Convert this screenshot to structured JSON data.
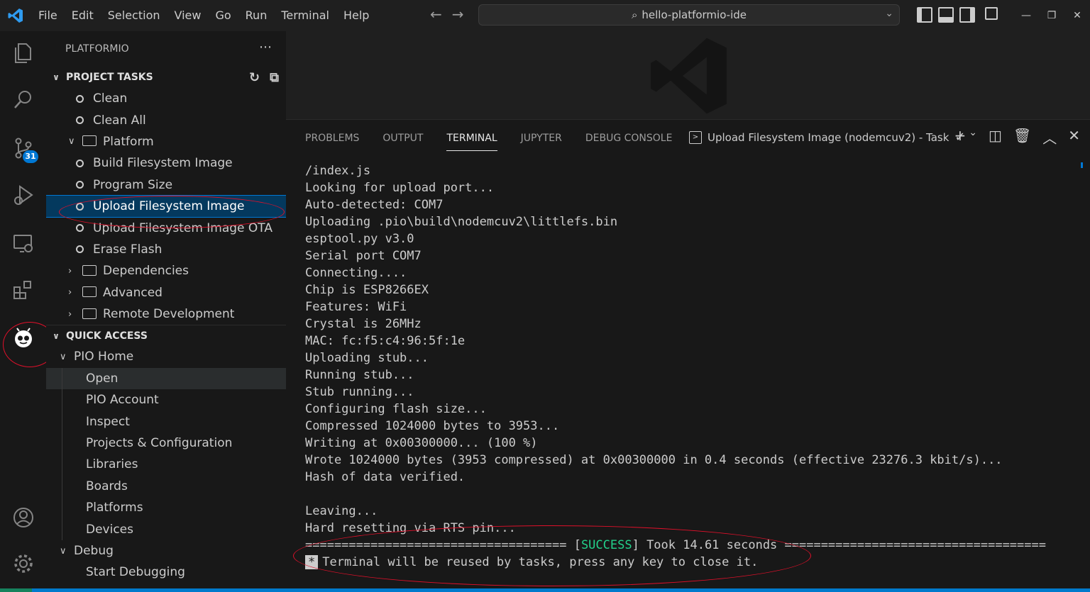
{
  "titlebar": {
    "menu": [
      "File",
      "Edit",
      "Selection",
      "View",
      "Go",
      "Run",
      "Terminal",
      "Help"
    ],
    "search_text": "hello-platformio-ide"
  },
  "activitybar": {
    "scm_badge": "31"
  },
  "sidebar": {
    "title": "PLATFORMIO",
    "project_tasks": {
      "header": "PROJECT TASKS",
      "items": {
        "clean": "Clean",
        "clean_all": "Clean All",
        "platform": "Platform",
        "build_fs": "Build Filesystem Image",
        "program_size": "Program Size",
        "upload_fs": "Upload Filesystem Image",
        "upload_fs_ota": "Upload Filesystem Image OTA",
        "erase_flash": "Erase Flash",
        "dependencies": "Dependencies",
        "advanced": "Advanced",
        "remote_dev": "Remote Development"
      }
    },
    "quick_access": {
      "header": "QUICK ACCESS",
      "pio_home": "PIO Home",
      "open": "Open",
      "pio_account": "PIO Account",
      "inspect": "Inspect",
      "projects": "Projects & Configuration",
      "libraries": "Libraries",
      "boards": "Boards",
      "platforms": "Platforms",
      "devices": "Devices",
      "debug": "Debug",
      "start_debugging": "Start Debugging"
    }
  },
  "panel": {
    "tabs": {
      "problems": "PROBLEMS",
      "output": "OUTPUT",
      "terminal": "TERMINAL",
      "jupyter": "JUPYTER",
      "debug_console": "DEBUG CONSOLE"
    },
    "task_name": "Upload Filesystem Image (nodemcuv2) - Task",
    "terminal_lines": {
      "l1": "/index.js",
      "l2": "Looking for upload port...",
      "l3": "Auto-detected: COM7",
      "l4": "Uploading .pio\\build\\nodemcuv2\\littlefs.bin",
      "l5": "esptool.py v3.0",
      "l6": "Serial port COM7",
      "l7": "Connecting....",
      "l8": "Chip is ESP8266EX",
      "l9": "Features: WiFi",
      "l10": "Crystal is 26MHz",
      "l11": "MAC: fc:f5:c4:96:5f:1e",
      "l12": "Uploading stub...",
      "l13": "Running stub...",
      "l14": "Stub running...",
      "l15": "Configuring flash size...",
      "l16": "Compressed 1024000 bytes to 3953...",
      "l17": "Writing at 0x00300000... (100 %)",
      "l18": "Wrote 1024000 bytes (3953 compressed) at 0x00300000 in 0.4 seconds (effective 23276.3 kbit/s)...",
      "l19": "Hash of data verified.",
      "l21": "Leaving...",
      "l22": "Hard resetting via RTS pin...",
      "sep_left": "==================================== [",
      "success": "SUCCESS",
      "sep_right": "] Took 14.61 seconds ====================================",
      "cursor": "*",
      "reuse": "Terminal will be reused by tasks, press any key to close it."
    }
  }
}
